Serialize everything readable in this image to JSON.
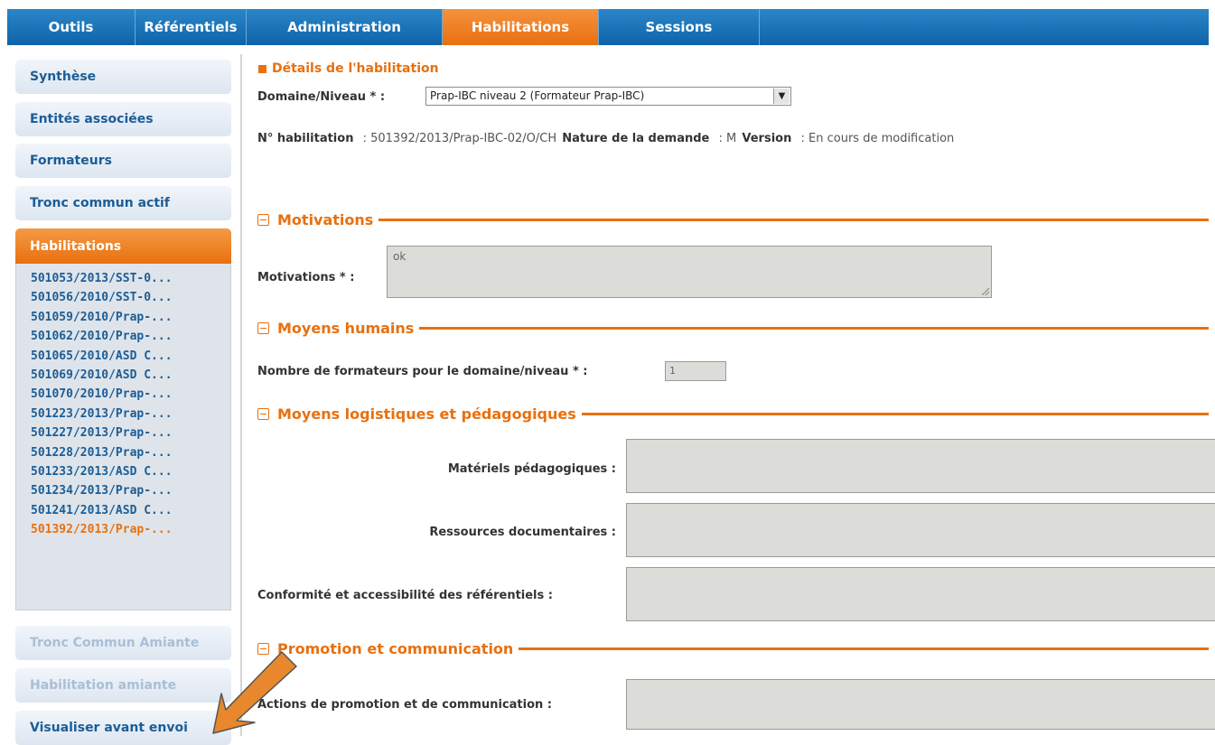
{
  "nav": {
    "tabs": [
      {
        "label": "Outils"
      },
      {
        "label": "Référentiels"
      },
      {
        "label": "Administration"
      },
      {
        "label": "Habilitations"
      },
      {
        "label": "Sessions"
      }
    ],
    "active_tab": "Habilitations"
  },
  "sidebar": {
    "synthese": "Synthèse",
    "entites": "Entités associées",
    "formateurs": "Formateurs",
    "tronc": "Tronc commun actif",
    "habilitations": "Habilitations",
    "hab_items": [
      "501053/2013/SST-0...",
      "501056/2010/SST-0...",
      "501059/2010/Prap-...",
      "501062/2010/Prap-...",
      "501065/2010/ASD C...",
      "501069/2010/ASD C...",
      "501070/2010/Prap-...",
      "501223/2013/Prap-...",
      "501227/2013/Prap-...",
      "501228/2013/Prap-...",
      "501233/2013/ASD C...",
      "501234/2013/Prap-...",
      "501241/2013/ASD C...",
      "501392/2013/Prap-..."
    ],
    "current_item": "501392/2013/Prap-...",
    "tronc_amiante": "Tronc Commun Amiante",
    "hab_amiante": "Habilitation amiante",
    "visualiser": "Visualiser avant envoi"
  },
  "details": {
    "title": "Détails de l'habilitation",
    "domaine_label": "Domaine/Niveau * :",
    "domaine_value": "Prap-IBC niveau 2 (Formateur Prap-IBC)",
    "num_label": "N° habilitation",
    "num_value": ": 501392/2013/Prap-IBC-02/O/CH",
    "nature_label": "Nature de la demande",
    "nature_value": ": M",
    "version_label": "Version",
    "version_value": ": En cours de modification"
  },
  "motivations": {
    "section": "Motivations",
    "label": "Motivations * :",
    "value": "ok"
  },
  "moyens_humains": {
    "section": "Moyens humains",
    "label": "Nombre de formateurs pour le domaine/niveau * :",
    "value": "1"
  },
  "moyens_logistiques": {
    "section": "Moyens logistiques et pédagogiques",
    "materiels": "Matériels pédagogiques :",
    "ressources": "Ressources documentaires :",
    "conformite": "Conformité et accessibilité des référentiels :"
  },
  "promotion": {
    "section": "Promotion et communication",
    "actions": "Actions de promotion et de communication :"
  },
  "colors": {
    "nav_blue": "#0f63a8",
    "accent_orange": "#e8700f",
    "link_blue": "#1b5d96"
  }
}
